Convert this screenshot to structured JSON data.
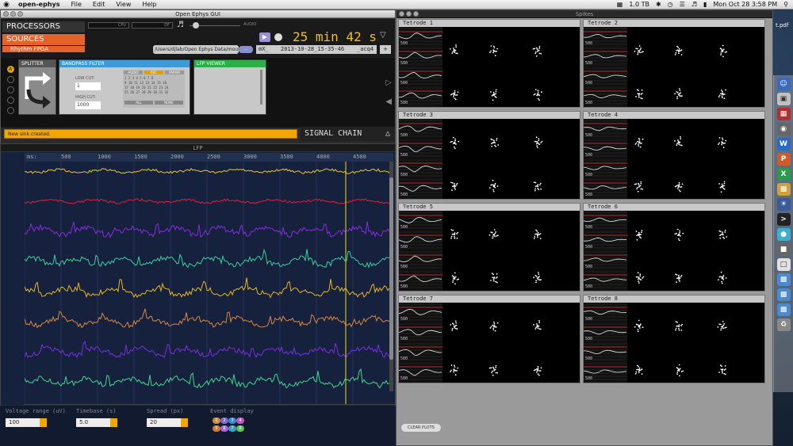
{
  "menubar": {
    "app_name": "open-ephys",
    "items": [
      "File",
      "Edit",
      "View",
      "Help"
    ],
    "disk": "1.0 TB",
    "datetime": "Mon Oct 28  3:58 PM"
  },
  "main_window": {
    "title": "Open Ephys GUI",
    "processors_tab": "PROCESSORS",
    "sources_tab": "SOURCES",
    "sources_sub": "Rhythm FPGA",
    "cpu_label": "CPU",
    "df_label": "DF",
    "audio_label": "AUDIO",
    "clock": "25 min 42 s",
    "data_path": "/Users/djlab/Open Ephys Data/mouseX",
    "path_button": "...",
    "prefix": "mX_",
    "date_field": "2013-10-28_15-35-46",
    "suffix": "_acq4",
    "plus": "+",
    "status_message": "New sink created.",
    "signal_chain_label": "SIGNAL CHAIN",
    "chain_active": "A"
  },
  "editors": {
    "splitter": {
      "title": "SPLITTER"
    },
    "bandpass": {
      "title": "BANDPASS FILTER",
      "low_cut_label": "LOW CUT:",
      "low_cut": "1",
      "high_cut_label": "HIGH CUT:",
      "high_cut": "1000",
      "col_headers": [
        "AUDIO",
        "REC",
        "PARAM"
      ],
      "rows": [
        "1 2 3 4 5 6 7 8",
        "9 10 11 12 13 14 15 16",
        "17 18 19 20 21 22 23 24",
        "25 26 27 28 29 30 31 32"
      ],
      "all": "ALL",
      "none": "NONE"
    },
    "lfp_viewer": {
      "title": "LFP VIEWER"
    }
  },
  "lfp_window": {
    "title": "LFP",
    "ruler_unit": "ms:",
    "ruler_ticks": [
      "500",
      "1000",
      "1500",
      "2000",
      "2500",
      "3000",
      "3500",
      "4000",
      "4500"
    ],
    "controls": {
      "voltage_label": "Voltage range (uV)",
      "voltage_value": "100",
      "timebase_label": "Timebase (s)",
      "timebase_value": "5.0",
      "spread_label": "Spread (px)",
      "spread_value": "20",
      "event_label": "Event display",
      "event_buttons": [
        "1",
        "2",
        "3",
        "4",
        "5",
        "6",
        "7",
        "8"
      ]
    }
  },
  "spikes_window": {
    "title": "Spikes",
    "tetrodes": [
      "Tetrode 1",
      "Tetrode 2",
      "Tetrode 3",
      "Tetrode 4",
      "Tetrode 5",
      "Tetrode 6",
      "Tetrode 7",
      "Tetrode 8"
    ],
    "axis_label": "500",
    "clear_button": "CLEAR PLOTS"
  },
  "desktop": {
    "file_label": "t.pdf"
  },
  "colors": {
    "accent_orange": "#e5622a",
    "status_yellow": "#f0a800",
    "clock_yellow": "#f0c020",
    "trace_colors": [
      "#e8c830",
      "#e0203a",
      "#8a2be2",
      "#3ad0a0",
      "#e8b820",
      "#d88840",
      "#7a30e0",
      "#40d890"
    ]
  }
}
